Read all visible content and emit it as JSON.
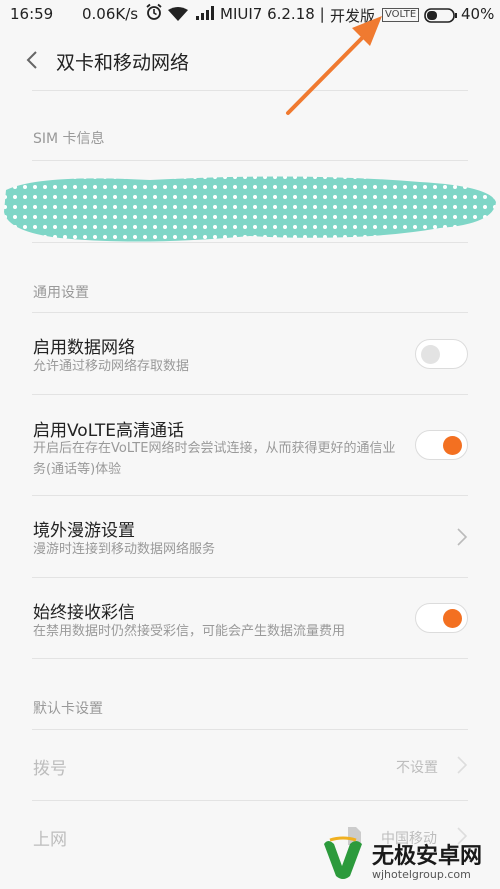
{
  "status_bar": {
    "time": "16:59",
    "speed": "0.06K/s",
    "carrier": "MIUI7 6.2.18",
    "separator": "|",
    "dev": "开发版",
    "volte": "VOLTE",
    "battery_pct": "40%",
    "battery_level": 0.4
  },
  "header": {
    "title": "双卡和移动网络"
  },
  "sim_section": {
    "title": "SIM 卡信息"
  },
  "general_section": {
    "title": "通用设置",
    "items": [
      {
        "title": "启用数据网络",
        "subtitle": "允许通过移动网络存取数据",
        "toggle": "off"
      },
      {
        "title": "启用VoLTE高清通话",
        "subtitle": "开启后在存在VoLTE网络时会尝试连接，从而获得更好的通信业务(通话等)体验",
        "toggle": "on"
      },
      {
        "title": "境外漫游设置",
        "subtitle": "漫游时连接到移动数据网络服务"
      },
      {
        "title": "始终接收彩信",
        "subtitle": "在禁用数据时仍然接受彩信，可能会产生数据流量费用",
        "toggle": "on"
      }
    ]
  },
  "default_section": {
    "title": "默认卡设置",
    "items": [
      {
        "title": "拨号",
        "value": "不设置"
      },
      {
        "title": "上网",
        "value": "中国移动"
      }
    ]
  },
  "watermark": {
    "title": "无极安卓网",
    "url": "wjhotelgroup.com"
  },
  "colors": {
    "accent": "#f37021",
    "arrow": "#f07a30",
    "redact": "#7fd6c7"
  }
}
